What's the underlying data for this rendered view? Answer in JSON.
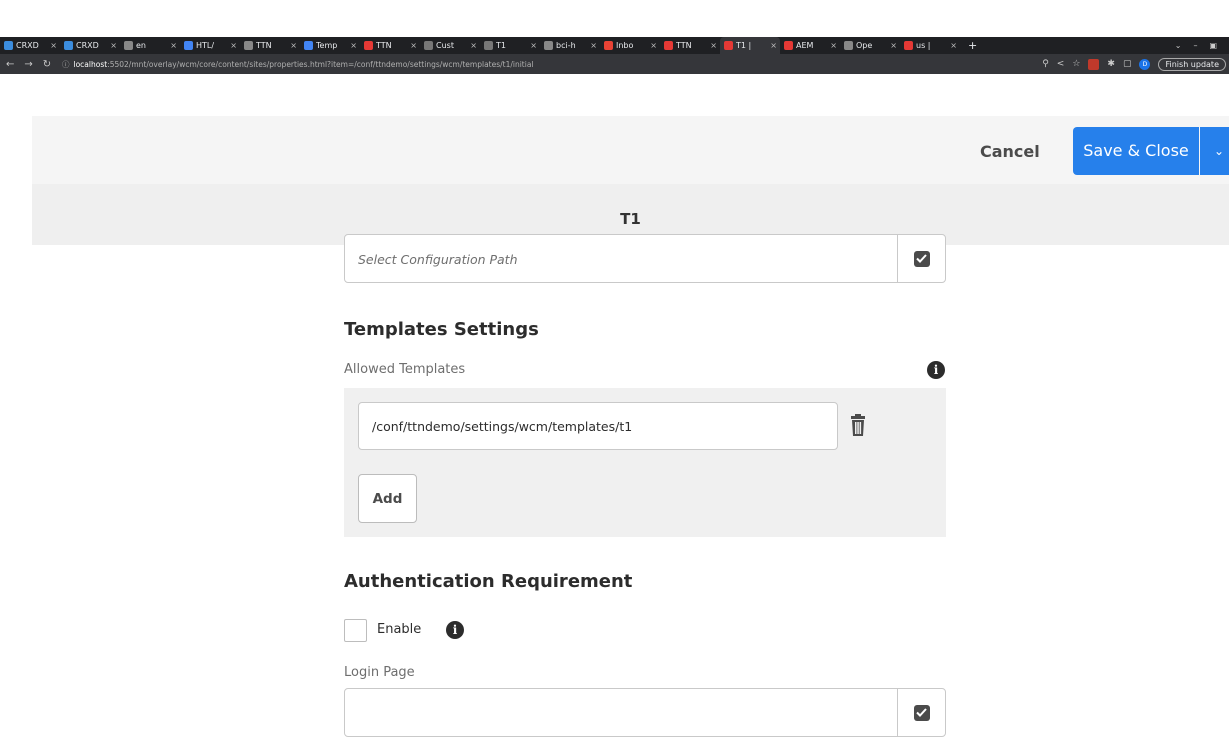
{
  "browser": {
    "tabs": [
      {
        "label": "CRXD",
        "color": "#3c8dde",
        "icon": "crx-icon"
      },
      {
        "label": "CRXD",
        "color": "#3c8dde",
        "icon": "crx-icon"
      },
      {
        "label": "en",
        "color": "#888888",
        "icon": "globe-icon"
      },
      {
        "label": "HTL/",
        "color": "#4285f4",
        "icon": "docs-icon"
      },
      {
        "label": "TTN",
        "color": "#888888",
        "icon": "globe-icon"
      },
      {
        "label": "Temp",
        "color": "#4285f4",
        "icon": "docs-icon"
      },
      {
        "label": "TTN",
        "color": "#e53935",
        "icon": "adobe-icon"
      },
      {
        "label": "Cust",
        "color": "#777777",
        "icon": "globe-icon"
      },
      {
        "label": "T1",
        "color": "#777777",
        "icon": "globe-icon"
      },
      {
        "label": "bci-h",
        "color": "#888888",
        "icon": "globe-icon"
      },
      {
        "label": "Inbo",
        "color": "#ea4335",
        "icon": "gmail-icon"
      },
      {
        "label": "TTN",
        "color": "#e53935",
        "icon": "adobe-icon"
      },
      {
        "label": "T1 |",
        "color": "#e53935",
        "icon": "adobe-icon"
      },
      {
        "label": "AEM",
        "color": "#e53935",
        "icon": "adobe-icon"
      },
      {
        "label": "Ope",
        "color": "#888888",
        "icon": "globe-icon"
      },
      {
        "label": "us |",
        "color": "#e53935",
        "icon": "adobe-icon"
      }
    ],
    "active_tab_index": 12,
    "new_tab": "+",
    "url_host": "localhost",
    "url_rest": ":5502/mnt/overlay/wcm/core/content/sites/properties.html?item=/conf/ttndemo/settings/wcm/templates/t1/initial",
    "avatar_letter": "D",
    "finish_update": "Finish update"
  },
  "toolbar": {
    "cancel_label": "Cancel",
    "save_label": "Save & Close"
  },
  "page": {
    "title": "T1"
  },
  "config_path": {
    "placeholder": "Select Configuration Path"
  },
  "templates_settings": {
    "heading": "Templates Settings",
    "allowed_label": "Allowed Templates",
    "template_value": "/conf/ttndemo/settings/wcm/templates/t1",
    "add_label": "Add"
  },
  "authentication": {
    "heading": "Authentication Requirement",
    "enable_label": "Enable",
    "enabled": false,
    "login_page_label": "Login Page",
    "login_page_value": ""
  },
  "colors": {
    "primary": "#2680eb",
    "chrome_dark": "#1f2023"
  }
}
